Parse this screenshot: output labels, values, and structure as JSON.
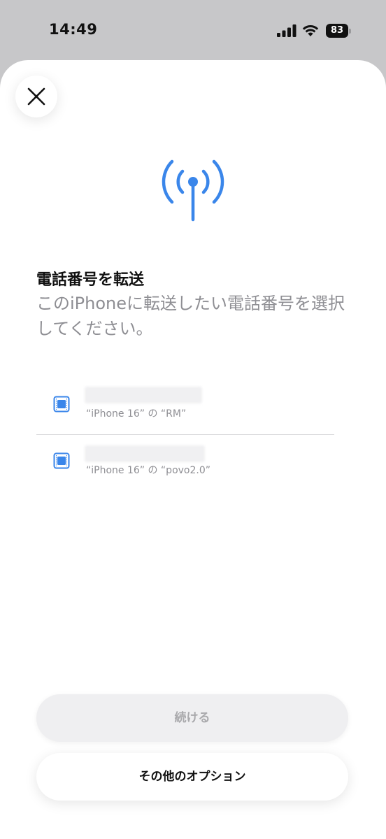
{
  "status_bar": {
    "time": "14:49",
    "battery_level": "83",
    "icons": [
      "signal-icon",
      "wifi-icon",
      "battery-icon"
    ]
  },
  "sheet": {
    "close_icon": "close-icon",
    "header_icon": "antenna-icon",
    "title": "電話番号を転送",
    "description": "このiPhoneに転送したい電話番号を選択してください。",
    "numbers": [
      {
        "label": "“iPhone 16” の “RM”",
        "icon": "sim-card-icon"
      },
      {
        "label": "“iPhone 16” の “povo2.0”",
        "icon": "sim-card-icon"
      }
    ],
    "continue_label": "続ける",
    "other_options_label": "その他のオプション"
  },
  "colors": {
    "accent": "#3a86ea",
    "background_dim": "#c7c7c9",
    "sheet": "#ffffff",
    "secondary_text": "#8e8e93"
  }
}
